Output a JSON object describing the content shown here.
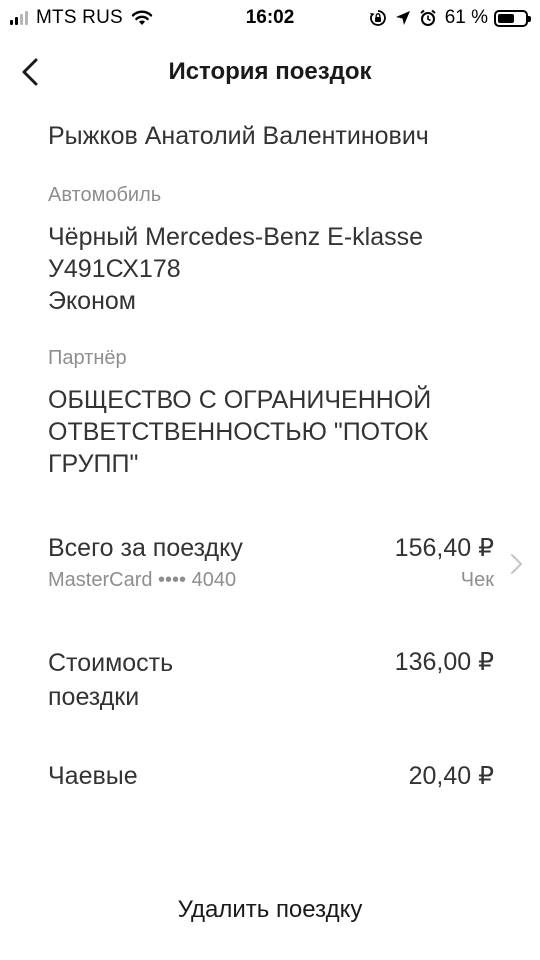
{
  "status_bar": {
    "carrier": "MTS RUS",
    "time": "16:02",
    "battery_percent": "61 %",
    "battery_level": 0.61
  },
  "nav": {
    "title": "История поездок"
  },
  "driver": {
    "name": "Рыжков Анатолий Валентинович"
  },
  "car": {
    "label": "Автомобиль",
    "model": "Чёрный Mercedes-Benz E-klasse",
    "plate": "У491СХ178",
    "class": "Эконом"
  },
  "partner": {
    "label": "Партнёр",
    "name": "ОБЩЕСТВО С ОГРАНИЧЕННОЙ ОТВЕТСТВЕННОСТЬЮ \"ПОТОК ГРУПП\""
  },
  "total": {
    "label": "Всего за поездку",
    "amount": "156,40 ₽",
    "card": "MasterCard •••• 4040",
    "receipt": "Чек"
  },
  "cost": {
    "label": "Стоимость поездки",
    "amount": "136,00 ₽"
  },
  "tips": {
    "label": "Чаевые",
    "amount": "20,40 ₽"
  },
  "actions": {
    "delete": "Удалить поездку"
  }
}
